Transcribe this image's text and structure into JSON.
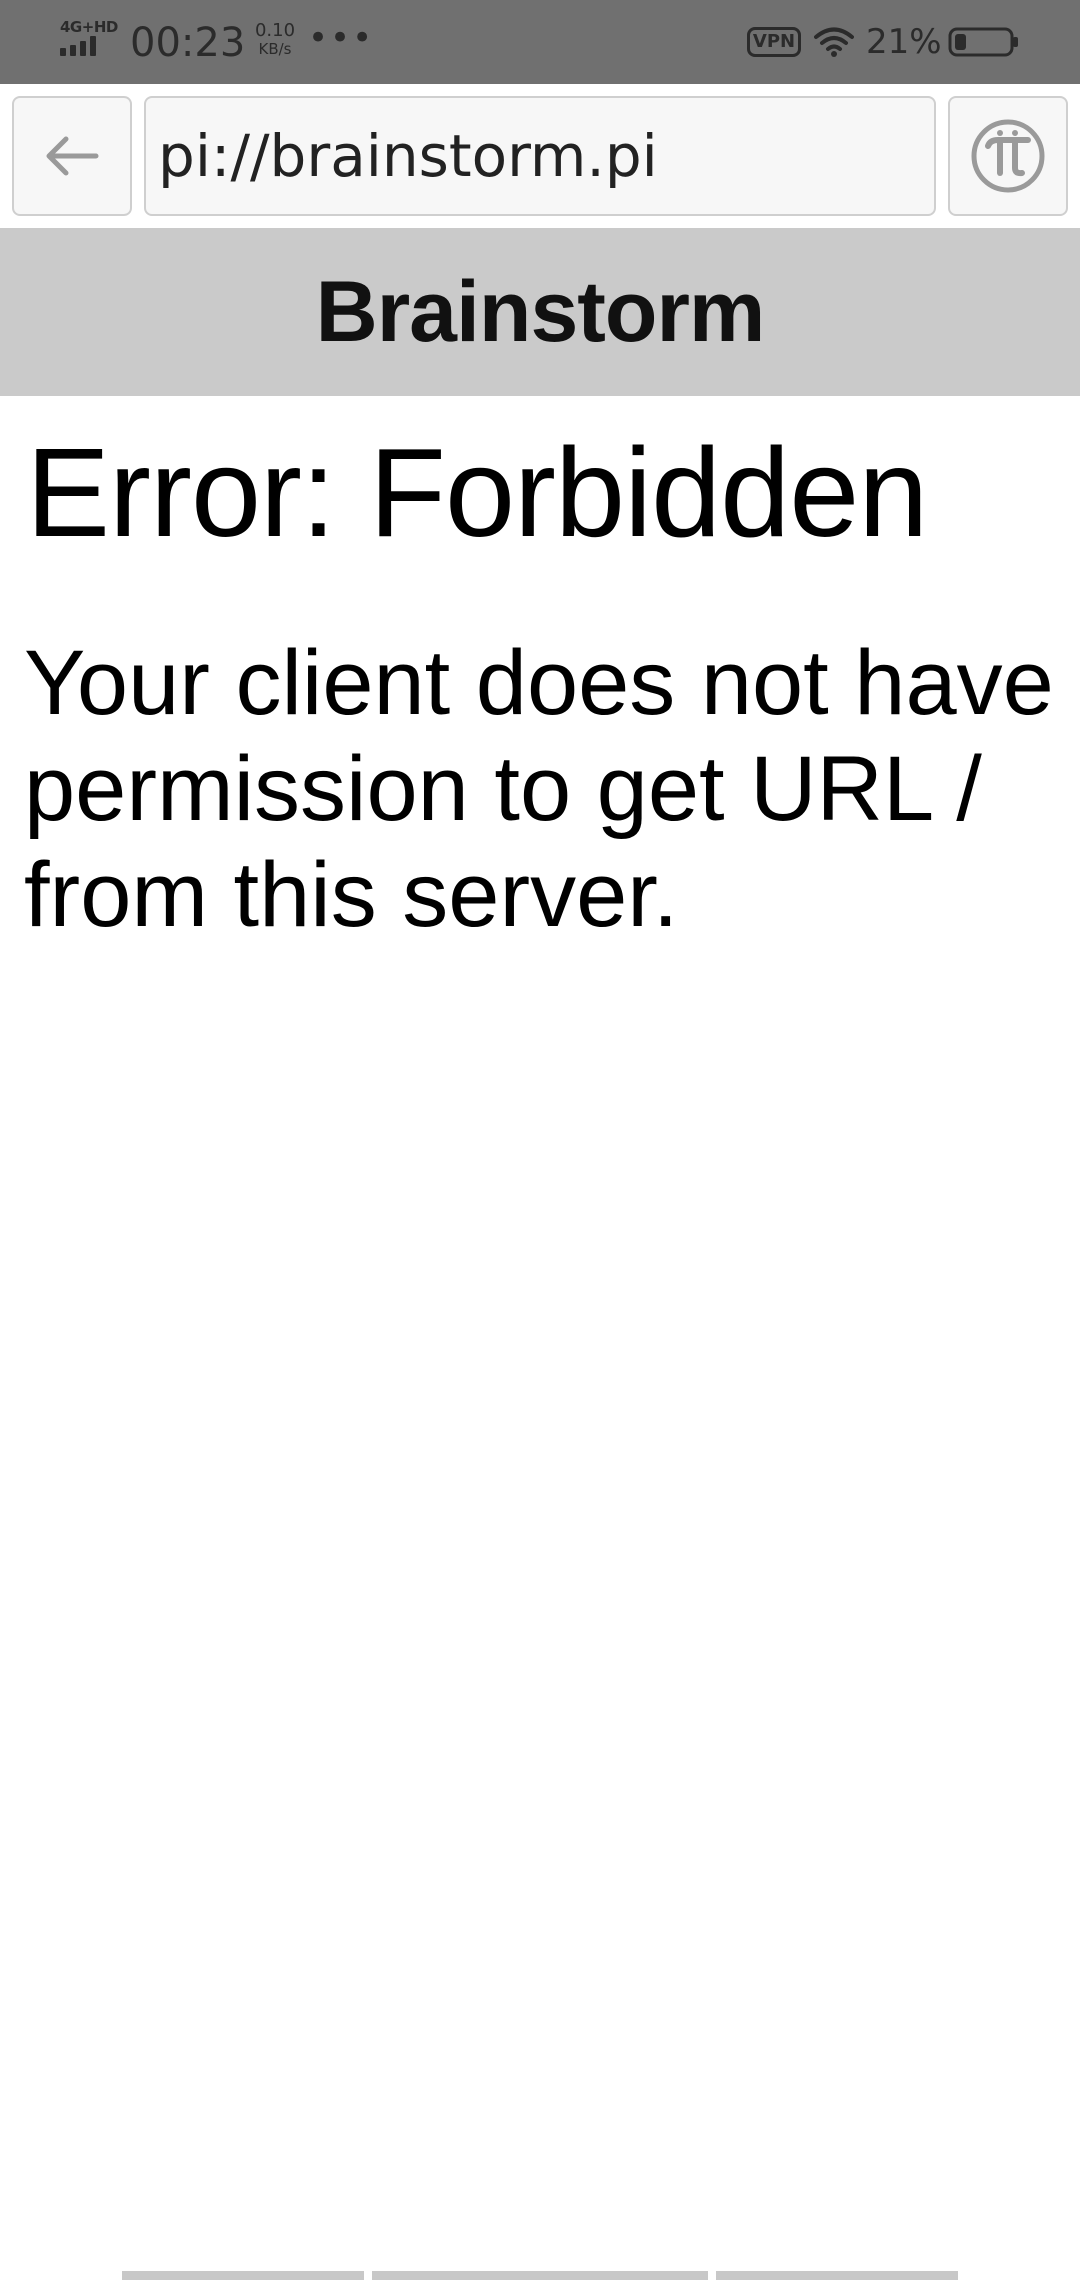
{
  "status_bar": {
    "network": "4G+HD",
    "time": "00:23",
    "speed_value": "0.10",
    "speed_unit": "KB/s",
    "more": "•••",
    "vpn": "VPN",
    "battery_percent": "21%",
    "battery_level": 0.21
  },
  "browser": {
    "url": "pi://brainstorm.pi",
    "back_icon": "arrow-left-icon",
    "pi_icon": "pi-logo-icon"
  },
  "site": {
    "title": "Brainstorm"
  },
  "error": {
    "heading": "Error: Forbidden",
    "message": "Your client does not have permission to get URL / from this server."
  },
  "colors": {
    "status_bar_bg": "#707070",
    "header_bg": "#cacaca",
    "icon_gray": "#9a9a9a"
  }
}
